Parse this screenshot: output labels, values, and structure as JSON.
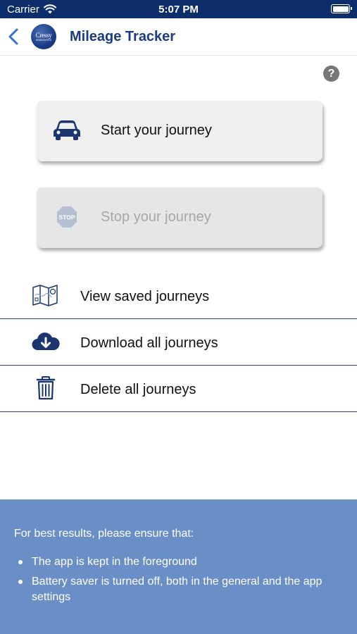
{
  "status_bar": {
    "carrier": "Carrier",
    "time": "5:07 PM"
  },
  "nav": {
    "title": "Mileage Tracker",
    "logo_text": "Cressy",
    "logo_subtext": "ASSOCIATES",
    "back_icon": "chevron-left-icon"
  },
  "help": {
    "symbol": "?"
  },
  "actions": {
    "start": {
      "label": "Start your journey",
      "icon": "car-icon",
      "enabled": true
    },
    "stop": {
      "label": "Stop your journey",
      "icon": "stop-sign-icon",
      "enabled": false
    }
  },
  "menu": [
    {
      "label": "View saved journeys",
      "icon": "map-icon"
    },
    {
      "label": "Download all journeys",
      "icon": "cloud-download-icon"
    },
    {
      "label": "Delete all journeys",
      "icon": "trash-icon"
    }
  ],
  "info": {
    "heading": "For best results, please ensure that:",
    "items": [
      "The app is kept in the foreground",
      "Battery saver is turned off, both in the general and the app settings"
    ]
  },
  "colors": {
    "status_bar": "#0d2d6b",
    "accent": "#1b3c7e",
    "info_panel": "#6a8fc6",
    "divider": "#27447e"
  }
}
